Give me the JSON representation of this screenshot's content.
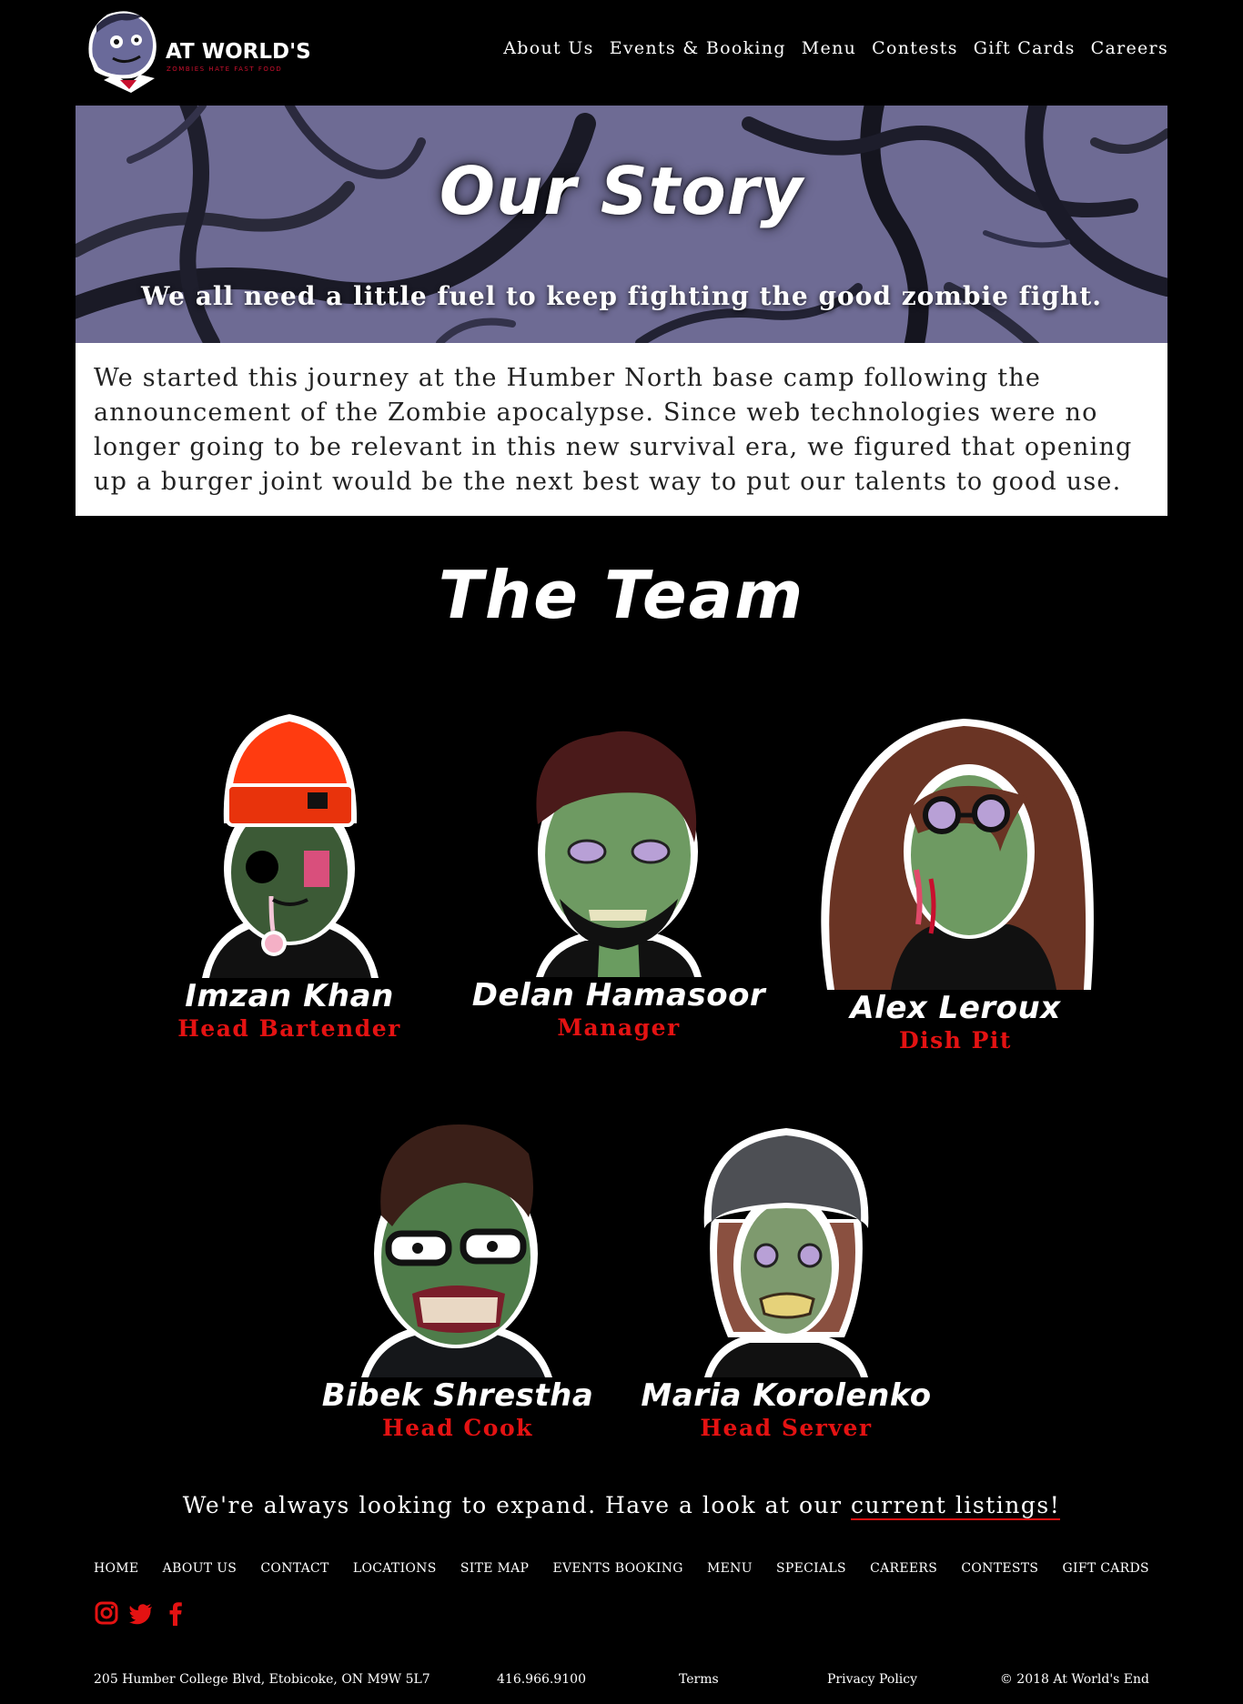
{
  "brand": {
    "name": "AT WORLD'S END",
    "tagline": "ZOMBIES HATE FAST FOOD"
  },
  "nav": {
    "items": [
      "About Us",
      "Events & Booking",
      "Menu",
      "Contests",
      "Gift Cards",
      "Careers"
    ]
  },
  "hero": {
    "title": "Our Story",
    "tagline": "We all need a little fuel to keep fighting the good zombie fight."
  },
  "story": {
    "text": "We started this journey at the Humber North base camp following the announcement of the Zombie apocalypse. Since web technologies were no longer going to be relevant in this new survival era, we figured that opening up a burger joint would be the next best way to put our talents to good use."
  },
  "team": {
    "title": "The Team",
    "members": [
      {
        "name": "Imzan Khan",
        "role": "Head Bartender"
      },
      {
        "name": "Delan Hamasoor",
        "role": "Manager"
      },
      {
        "name": "Alex Leroux",
        "role": "Dish Pit"
      },
      {
        "name": "Bibek Shrestha",
        "role": "Head Cook"
      },
      {
        "name": "Maria Korolenko",
        "role": "Head Server"
      }
    ]
  },
  "expand": {
    "text": "We're always looking to expand. Have a look at our ",
    "link": "current listings!"
  },
  "footer": {
    "nav": [
      "HOME",
      "ABOUT US",
      "CONTACT",
      "LOCATIONS",
      "SITE MAP",
      "EVENTS BOOKING",
      "MENU",
      "SPECIALS",
      "CAREERS",
      "CONTESTS",
      "GIFT CARDS"
    ],
    "social": [
      "instagram-icon",
      "twitter-icon",
      "facebook-icon"
    ],
    "address": "205 Humber College Blvd, Etobicoke, ON M9W 5L7",
    "phone": "416.966.9100",
    "terms": "Terms",
    "privacy": "Privacy Policy",
    "copyright": "© 2018 At World's End"
  },
  "colors": {
    "background": "#000000",
    "hero_bg": "#6e6b94",
    "accent_red": "#e41212",
    "zombie_skin": "#6e9a62"
  }
}
